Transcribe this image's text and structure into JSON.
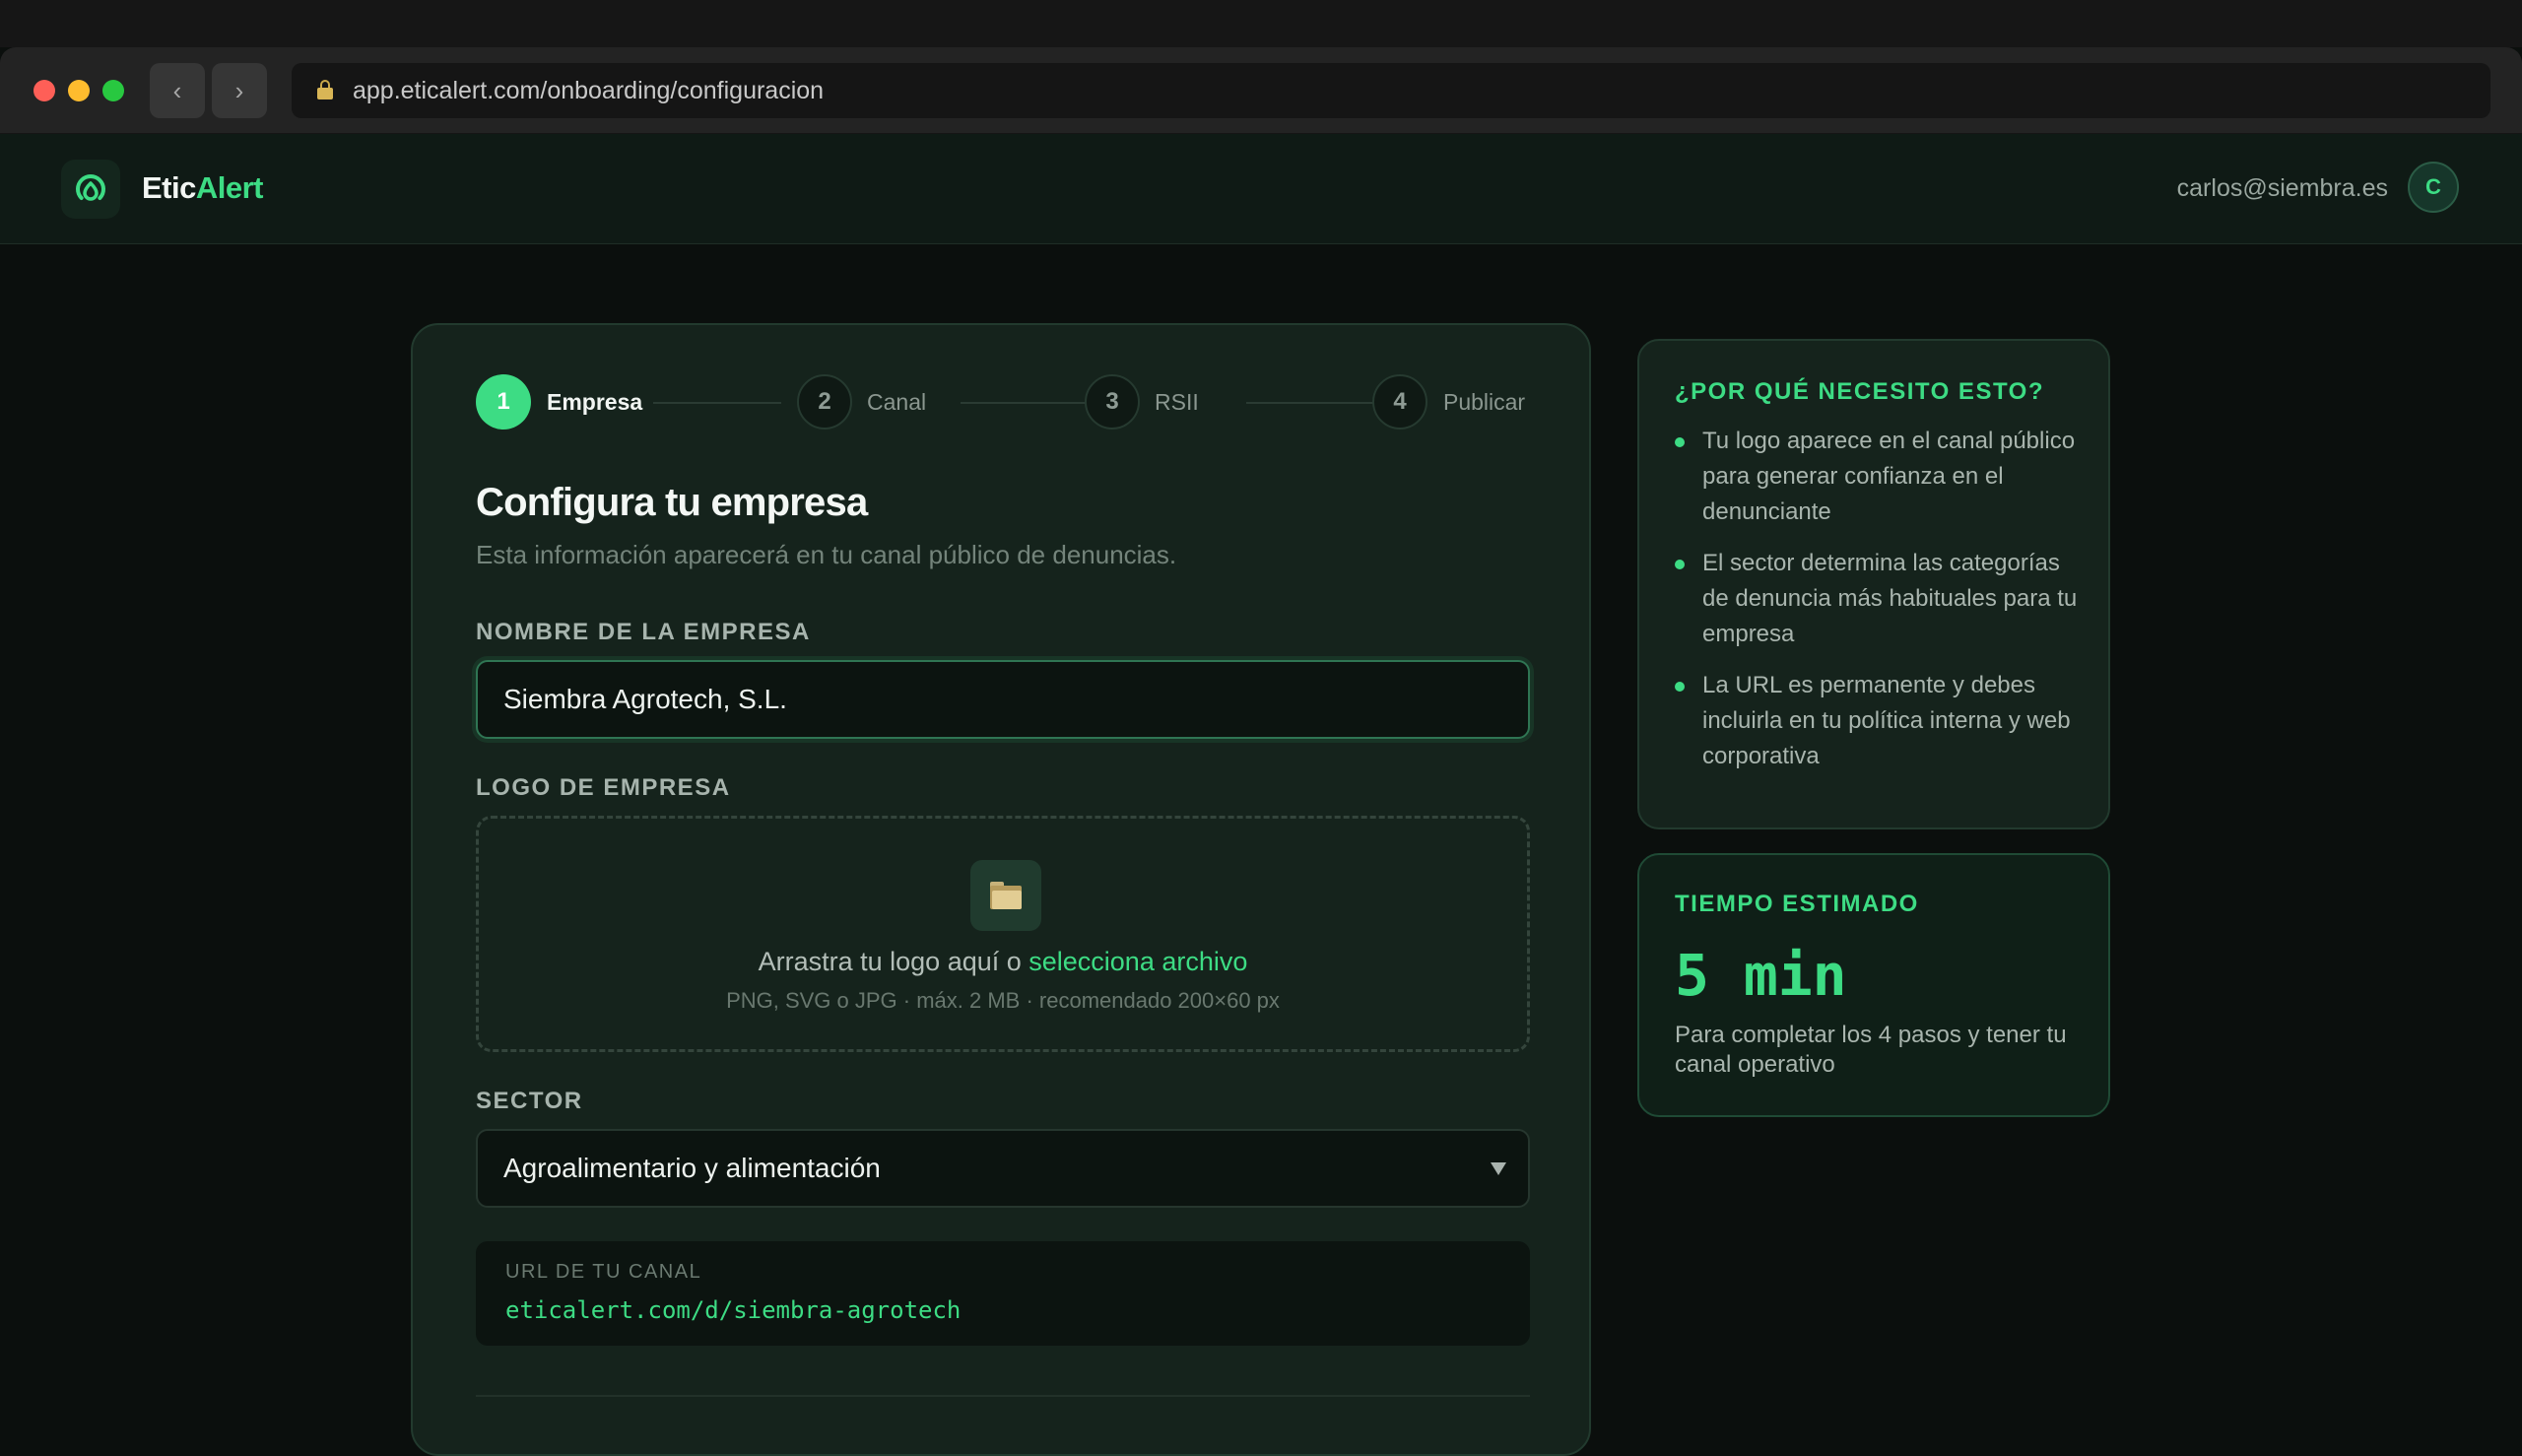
{
  "browser": {
    "url": "app.eticalert.com/onboarding/configuracion",
    "back_glyph": "‹",
    "forward_glyph": "›"
  },
  "header": {
    "brand_part1": "Etic",
    "brand_part2": "Alert",
    "user_email": "carlos@siembra.es",
    "avatar_initial": "C"
  },
  "steps": [
    {
      "number": "1",
      "label": "Empresa",
      "active": true
    },
    {
      "number": "2",
      "label": "Canal",
      "active": false
    },
    {
      "number": "3",
      "label": "RSII",
      "active": false
    },
    {
      "number": "4",
      "label": "Publicar",
      "active": false
    }
  ],
  "form": {
    "title": "Configura tu empresa",
    "subtitle": "Esta información aparecerá en tu canal público de denuncias.",
    "company_name_label": "NOMBRE DE LA EMPRESA",
    "company_name_value": "Siembra Agrotech, S.L.",
    "logo_label": "LOGO DE EMPRESA",
    "logo_drop_text": "Arrastra tu logo aquí o ",
    "logo_drop_link": "selecciona archivo",
    "logo_hint": "PNG, SVG o JPG · máx. 2 MB · recomendado 200×60 px",
    "sector_label": "SECTOR",
    "sector_value": "Agroalimentario y alimentación",
    "channel_url_label": "URL DE TU CANAL",
    "channel_url_value": "eticalert.com/d/siembra-agrotech"
  },
  "why_card": {
    "title": "¿POR QUÉ NECESITO ESTO?",
    "bullets": [
      "Tu logo aparece en el canal público para generar confianza en el denunciante",
      "El sector determina las categorías de denuncia más habituales para tu empresa",
      "La URL es permanente y debes incluirla en tu política interna y web corporativa"
    ]
  },
  "time_card": {
    "title": "TIEMPO ESTIMADO",
    "value": "5 min",
    "description": "Para completar los 4 pasos y tener tu canal operativo"
  },
  "colors": {
    "accent": "#3ddc84",
    "background": "#0b0f0d",
    "card": "#15231c"
  }
}
